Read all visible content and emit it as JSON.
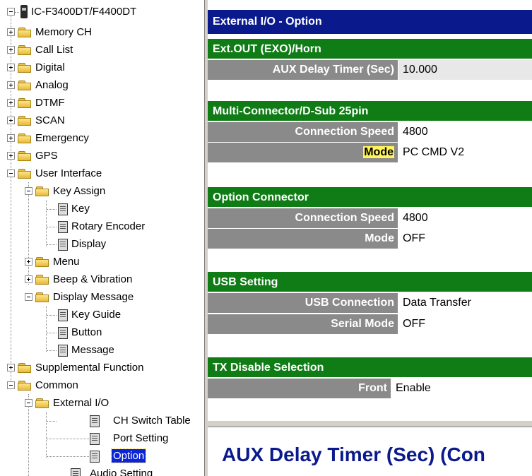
{
  "tree": {
    "root": "IC-F3400DT/F4400DT",
    "memory_ch": "Memory CH",
    "call_list": "Call List",
    "digital": "Digital",
    "analog": "Analog",
    "dtmf": "DTMF",
    "scan": "SCAN",
    "emergency": "Emergency",
    "gps": "GPS",
    "user_interface": "User Interface",
    "key_assign": "Key Assign",
    "key": "Key",
    "rotary_encoder": "Rotary Encoder",
    "display": "Display",
    "menu": "Menu",
    "beep_vibration": "Beep & Vibration",
    "display_message": "Display Message",
    "key_guide": "Key Guide",
    "button": "Button",
    "message": "Message",
    "supplemental_function": "Supplemental Function",
    "common": "Common",
    "external_io": "External I/O",
    "ch_switch_table": "CH Switch Table",
    "port_setting": "Port Setting",
    "option": "Option",
    "audio_setting": "Audio Setting"
  },
  "panel": {
    "title": "External I/O - Option",
    "sections": {
      "ext_out": {
        "title": "Ext.OUT (EXO)/Horn",
        "aux_delay_label": "AUX Delay Timer (Sec)",
        "aux_delay_value": "10.000"
      },
      "multi": {
        "title": "Multi-Connector/D-Sub 25pin",
        "speed_label": "Connection Speed",
        "speed_value": "4800",
        "mode_label": "Mode",
        "mode_value": "PC CMD V2"
      },
      "option_conn": {
        "title": "Option Connector",
        "speed_label": "Connection Speed",
        "speed_value": "4800",
        "mode_label": "Mode",
        "mode_value": "OFF"
      },
      "usb": {
        "title": "USB Setting",
        "conn_label": "USB Connection",
        "conn_value": "Data Transfer",
        "serial_label": "Serial Mode",
        "serial_value": "OFF"
      },
      "tx": {
        "title": "TX Disable Selection",
        "front_label": "Front",
        "front_value": "Enable"
      }
    },
    "description_title": "AUX Delay Timer (Sec) (Con"
  },
  "colors": {
    "header_blue": "#0a1a8c",
    "section_green": "#107c16",
    "label_gray": "#8a8a8a",
    "highlight_yellow": "#fff55a",
    "selection_blue": "#0a24d6"
  }
}
